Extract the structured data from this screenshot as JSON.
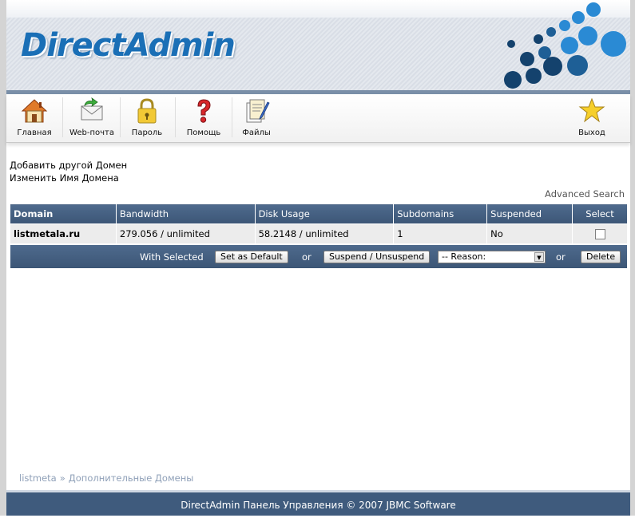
{
  "header": {
    "logo_text": "DirectAdmin"
  },
  "toolbar": {
    "items": [
      {
        "label": "Главная",
        "icon": "home-icon"
      },
      {
        "label": "Web-почта",
        "icon": "mail-icon"
      },
      {
        "label": "Пароль",
        "icon": "lock-icon"
      },
      {
        "label": "Помощь",
        "icon": "help-icon"
      },
      {
        "label": "Файлы",
        "icon": "files-icon"
      },
      {
        "label": "Выход",
        "icon": "star-icon"
      }
    ]
  },
  "links": {
    "add_domain": "Добавить другой Домен",
    "rename_domain": "Изменить Имя Домена"
  },
  "advanced_search": "Advanced Search",
  "table": {
    "headers": [
      "Domain",
      "Bandwidth",
      "Disk Usage",
      "Subdomains",
      "Suspended",
      "Select"
    ],
    "rows": [
      {
        "domain": "listmetala.ru",
        "bandwidth": "279.056 / unlimited",
        "disk_usage": "58.2148 / unlimited",
        "subdomains": "1",
        "suspended": "No",
        "selected": false
      }
    ]
  },
  "actions": {
    "with_selected": "With Selected",
    "set_default": "Set as Default",
    "or1": "or",
    "suspend": "Suspend / Unsuspend",
    "reason_selected": "-- Reason:",
    "or2": "or",
    "delete": "Delete"
  },
  "breadcrumb": {
    "root": "listmeta",
    "separator": "»",
    "current": "Дополнительные Домены"
  },
  "footer": {
    "text": "DirectAdmin Панель Управления © 2007 JBMC Software"
  },
  "colors": {
    "brand_blue": "#1a6fb6",
    "bar_blue": "#3f5b7d"
  }
}
